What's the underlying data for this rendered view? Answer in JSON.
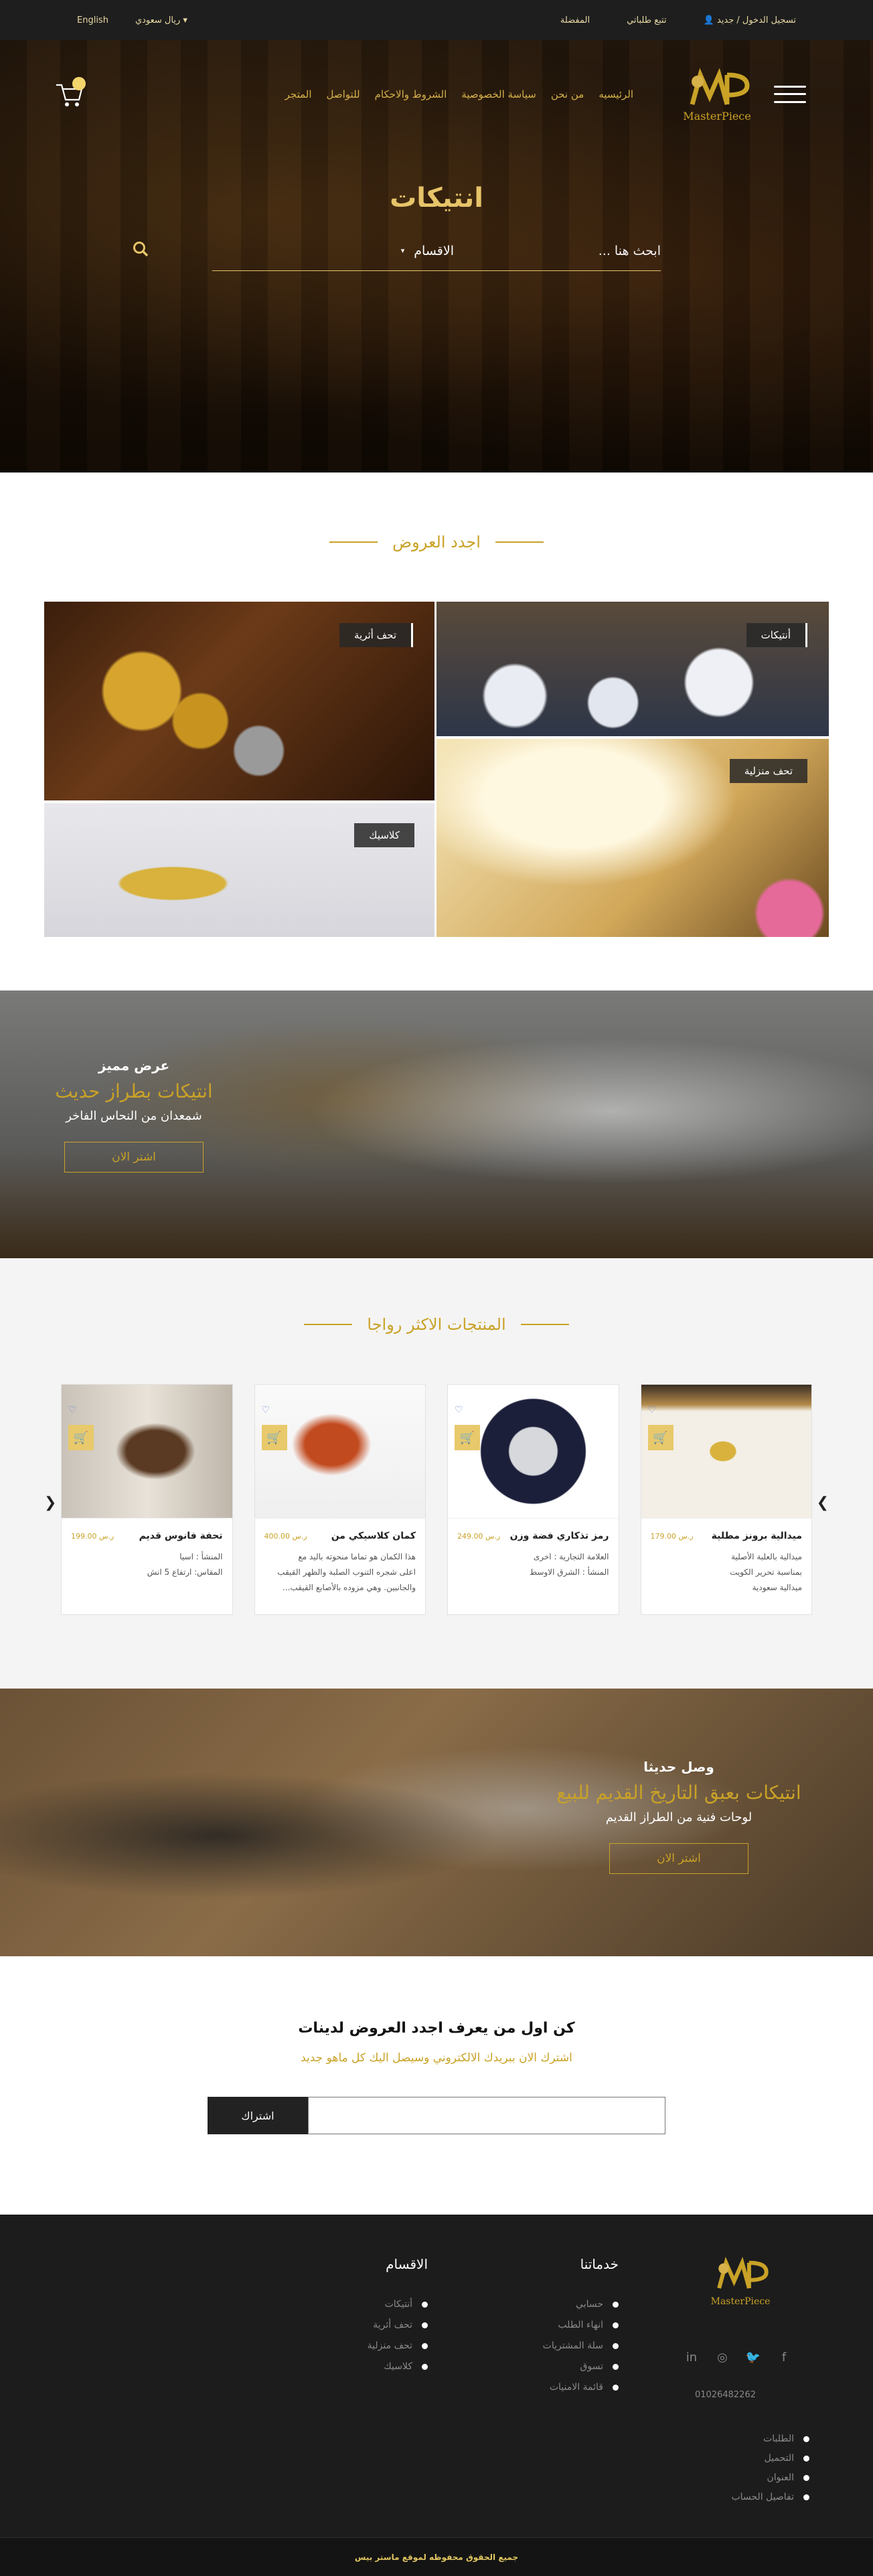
{
  "topbar": {
    "language": "English",
    "currency": "ريال سعودي",
    "favorites": "المفضلة",
    "track_order": "تتبع طلباتي",
    "login": "تسجيل الدخول / جديد"
  },
  "nav": {
    "brand": "MasterPiece",
    "menu": [
      "الرئيسيه",
      "من نحن",
      "سياسة الخصوصية",
      "الشروط والاحكام",
      "للتواصل",
      "المتجر"
    ]
  },
  "hero": {
    "title": "انتيكات",
    "search_placeholder": "ابحث هنا ...",
    "category_label": "الاقسام"
  },
  "offers": {
    "title": "اجدد العروض",
    "tiles": [
      "تحف أثرية",
      "كلاسيك",
      "أنتيكات",
      "تحف منزلية"
    ]
  },
  "banner1": {
    "kicker": "عرض مميز",
    "title": "انتيكات بطراز حديث",
    "subtitle": "شمعدان من النحاس الفاخر",
    "button": "اشتر الان"
  },
  "products": {
    "title": "المنتجات الاكثر رواجا",
    "items": [
      {
        "name": "تحفة فانوس قديم",
        "price": "ر.س 199.00",
        "desc1": "المنشأ : اسيا",
        "desc2": "المقاس: ارتفاع 5 انش"
      },
      {
        "name": "كمان كلاسيكي من",
        "price": "ر.س 400.00",
        "desc1": "هذا الكمان هو تماما منحوته باليد مع",
        "desc2": "اعلى شجره التنوب الصلبة والظهر القيقب والجانبين. وهي مزوده بالأصابع القيقب..."
      },
      {
        "name": "رمز تذكاري فضة وزن",
        "price": "ر.س 249.00",
        "desc1": "العلامة التجارية : اخرى",
        "desc2": "المنشأ : الشرق الاوسط"
      },
      {
        "name": "ميدالية برونز مطلية",
        "price": "ر.س 179.00",
        "desc1": "ميدالية بالعلبة الأصلية",
        "desc2": "بمناسبة تحرير الكويت",
        "desc3": "ميدالية سعودية"
      }
    ]
  },
  "banner2": {
    "kicker": "وصل حديثا",
    "title": "انتيكات بعبق التاريخ القديم للبيع",
    "subtitle": "لوحات فنية من الطراز القديم",
    "button": "اشتر الان"
  },
  "newsletter": {
    "heading": "كن اول من يعرف اجدد العروض لدينات",
    "sub": "اشترك الان ببريدك الالكتروني وسيصل اليك كل ماهو جديد",
    "button": "اشتراك"
  },
  "footer": {
    "brand": "MasterPiece",
    "services_title": "خدماتنا",
    "services": [
      "حسابي",
      "انهاء الطلب",
      "سلة المشتريات",
      "تسوق",
      "قائمة الامنيات"
    ],
    "categories_title": "الاقسام",
    "categories": [
      "أنتيكات",
      "تحف أثرية",
      "تحف منزلية",
      "كلاسيك"
    ],
    "phone": "01026482262",
    "links": [
      "الطلبات",
      "التحميل",
      "العنوان",
      "تفاصيل الحساب"
    ],
    "copyright": "جميع الحقوق محفوظه لموقع ماستر بيس"
  },
  "colors": {
    "gold": "#c9a227",
    "dark": "#1c1c1c"
  }
}
